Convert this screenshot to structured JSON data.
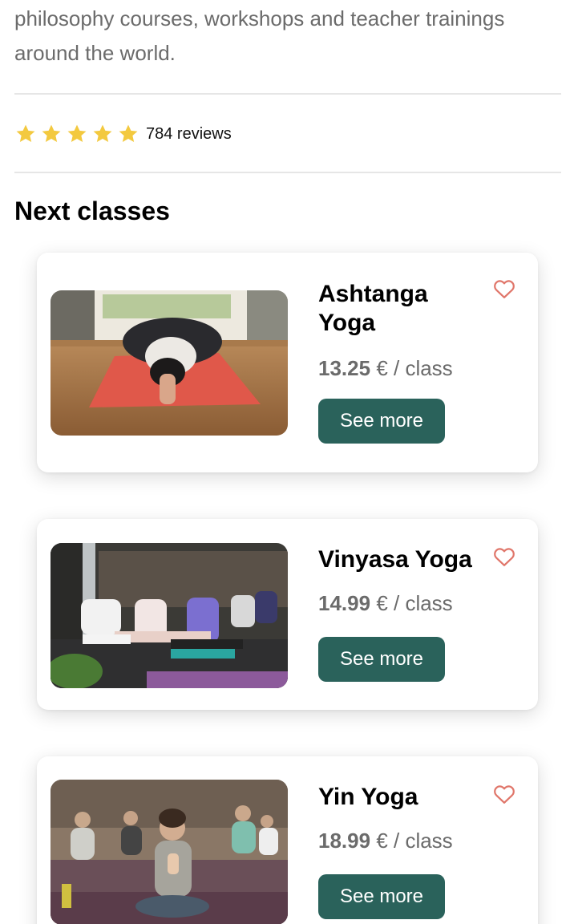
{
  "intro": {
    "text": "philosophy courses, workshops and teacher trainings around the world."
  },
  "rating": {
    "stars": 5,
    "reviews_label": "784 reviews",
    "star_color": "#f3c93f"
  },
  "next_classes": {
    "title": "Next classes",
    "classes": [
      {
        "title": "Ashtanga Yoga",
        "price": "13.25",
        "unit": "€ / class",
        "button_label": "See more",
        "image_icon": "yoga-child-pose-photo"
      },
      {
        "title": "Vinyasa Yoga",
        "price": "14.99",
        "unit": "€ / class",
        "button_label": "See more",
        "image_icon": "yoga-group-warrior-photo"
      },
      {
        "title": "Yin Yoga",
        "price": "18.99",
        "unit": "€ / class",
        "button_label": "See more",
        "image_icon": "yoga-group-meditation-photo"
      }
    ]
  },
  "colors": {
    "button": "#2a625b",
    "heart": "#e0766a",
    "muted_text": "#6b6b6b"
  }
}
